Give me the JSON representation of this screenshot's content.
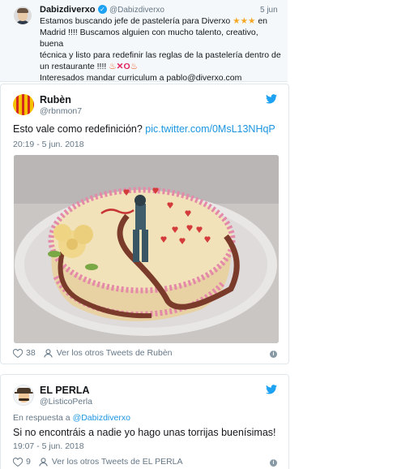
{
  "quoted_tweet": {
    "name": "Dabizdiverxo",
    "handle": "@Dabizdiverxo",
    "date": "5 jun",
    "text_line1": "Estamos buscando jefe de pastelería para Diverxo",
    "text_line1_end": "en",
    "text_line2": "Madrid !!!! Buscamos alguien con mucho talento, creativo, buena",
    "text_line3": "técnica y listo para redefinir las reglas de la pastelería dentro de",
    "text_line4": "un restaurante !!!!",
    "text_line5": "Interesados mandar curriculum a pablo@diverxo.com"
  },
  "tweet1": {
    "name": "Rubèn",
    "handle": "@rbnmon7",
    "text": "Esto vale como redefinición?",
    "link": "pic.twitter.com/0MsL13NHqP",
    "timestamp": "20:19 - 5 jun. 2018",
    "likes": "38",
    "more_tweets": "Ver los otros Tweets de Rubèn",
    "photo_alt": "cake"
  },
  "tweet2": {
    "name": "EL PERLA",
    "handle": "@ListicoPerla",
    "reply_prefix": "En respuesta a",
    "reply_handle": "@Dabizdiverxo",
    "text": "Si no encontráis a nadie yo hago unas torrijas buenísimas!",
    "timestamp": "19:07 - 5 jun. 2018",
    "likes": "9",
    "more_tweets": "Ver los otros Tweets de EL PERLA"
  },
  "colors": {
    "link": "#1b95e0",
    "muted": "#657786",
    "twitter_blue": "#1da1f2"
  },
  "icons": [
    "verified-icon",
    "twitter-bird-icon",
    "heart-icon",
    "person-icon",
    "info-icon",
    "star-icon",
    "fire-icon",
    "cross-icon"
  ]
}
